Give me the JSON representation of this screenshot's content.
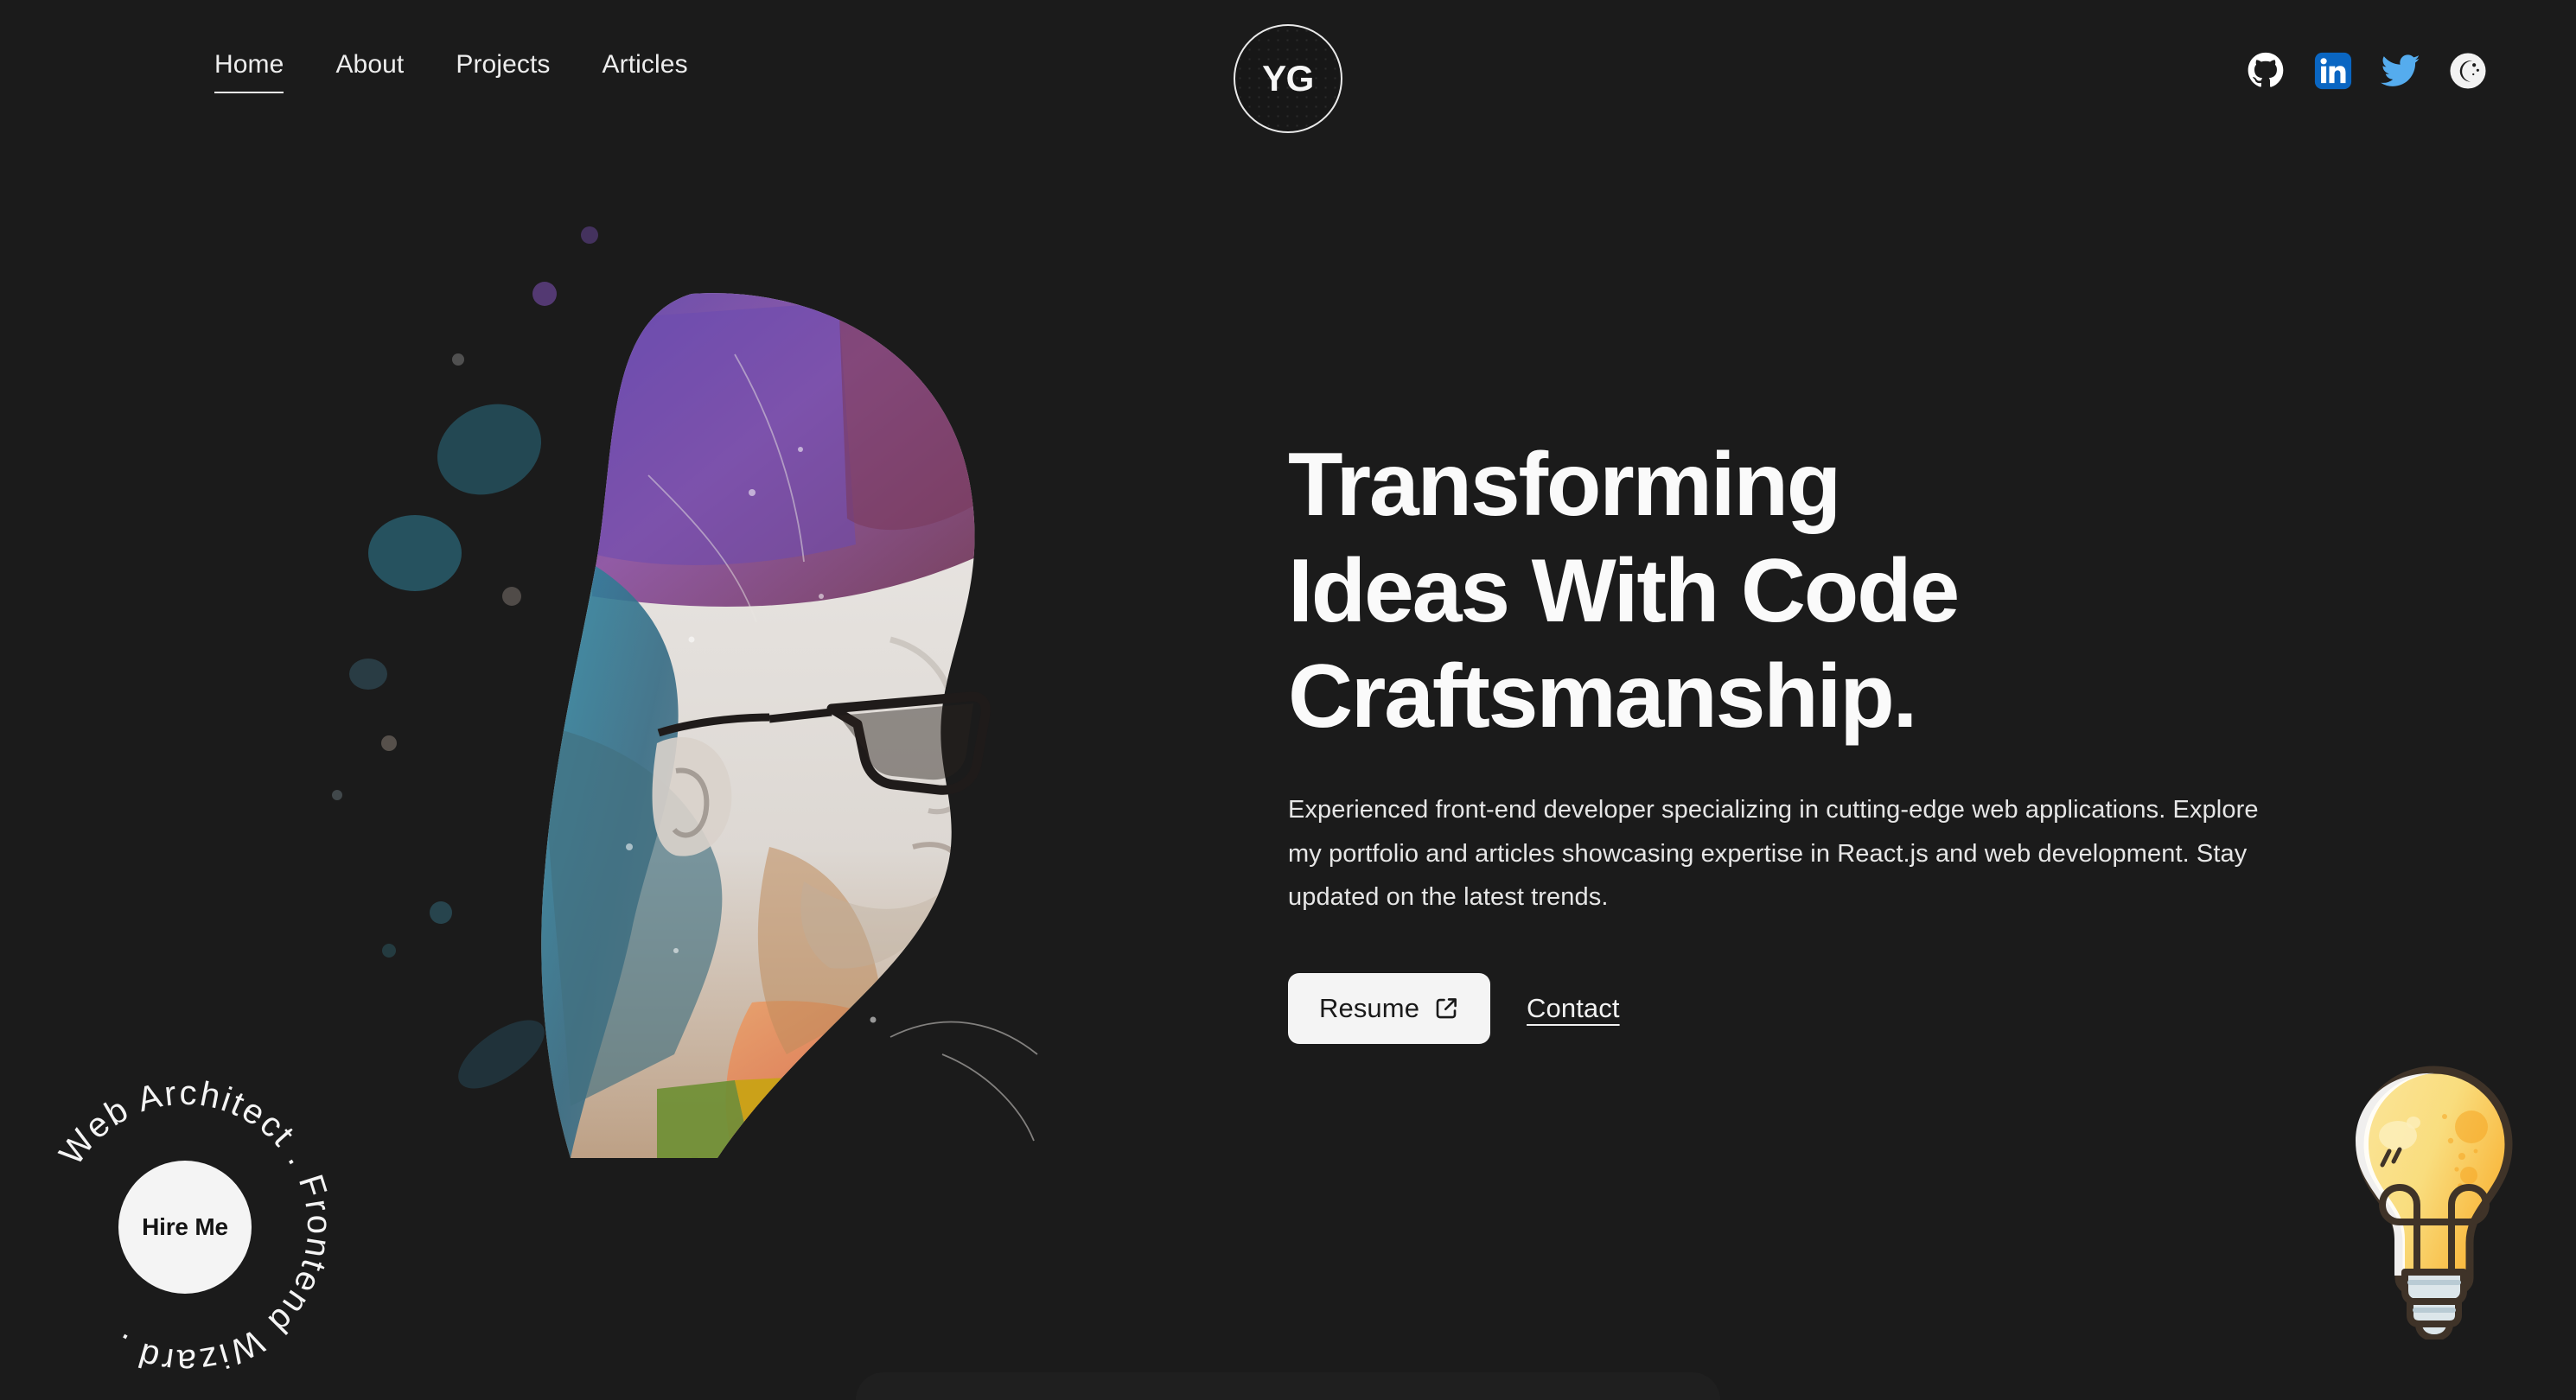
{
  "theme": {
    "background": "#1b1b1b",
    "text_primary": "#fafafa",
    "text_secondary": "#e6e6e6",
    "accent_surface": "#f4f4f4",
    "accent_text": "#1a1a1a",
    "linkedin_blue": "#0A66C2",
    "twitter_blue": "#55ACEE",
    "github_white": "#ffffff",
    "bulb_yellow": "#F9D85E",
    "bulb_amber": "#F9B233",
    "bulb_outline": "#3F3328"
  },
  "header": {
    "logo": {
      "text": "YG",
      "name": "site-logo"
    },
    "nav": {
      "items": [
        {
          "label": "Home",
          "active": true
        },
        {
          "label": "About",
          "active": false
        },
        {
          "label": "Projects",
          "active": false
        },
        {
          "label": "Articles",
          "active": false
        }
      ]
    },
    "socials": [
      {
        "name": "github-icon",
        "label": "GitHub"
      },
      {
        "name": "linkedin-icon",
        "label": "LinkedIn"
      },
      {
        "name": "twitter-icon",
        "label": "Twitter"
      },
      {
        "name": "dark-mode-toggle-icon",
        "label": "Dark mode"
      }
    ]
  },
  "hero": {
    "title_line_1": "Transforming",
    "title_line_2": "Ideas With Code",
    "title_line_3": "Craftsmanship.",
    "description": "Experienced front-end developer specializing in cutting-edge web applications. Explore my portfolio and articles showcasing expertise in React.js and web development. Stay updated on the latest trends.",
    "resume_label": "Resume",
    "contact_label": "Contact",
    "portrait_alt": "Watercolor splatter portrait of a developer in profile wearing glasses"
  },
  "hire_badge": {
    "ring_text": "Web Architect . Frontend Wizard . ",
    "core_label": "Hire Me"
  },
  "decor": {
    "lightbulb_label": "Idea lightbulb illustration"
  }
}
